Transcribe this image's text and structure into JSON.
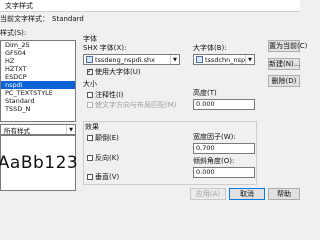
{
  "window": {
    "title": "文字样式"
  },
  "current_style": {
    "label": "当前文字样式：",
    "value": "Standard"
  },
  "styles": {
    "label": "样式(S):",
    "items": [
      "Dim_25",
      "GFS04",
      "HZ",
      "HZTXT",
      "ESDCP",
      "nspdi",
      "PC_TEXTSTYLE",
      "Standard",
      "TSSD_N"
    ],
    "selected_index": 5
  },
  "filter": {
    "value": "所有样式"
  },
  "preview": {
    "text": "AaBb123"
  },
  "font": {
    "group_label": "字体",
    "shx_label": "SHX 字体(X):",
    "shx_value": "tssdeng_nspdi.shx",
    "big_label": "大字体(B):",
    "big_value": "tssdchn_nspdi...",
    "use_big": {
      "label": "使用大字体(U)",
      "checked": true
    }
  },
  "size": {
    "group_label": "大小",
    "annotative": {
      "label": "注释性(I)",
      "checked": false
    },
    "match_orient": {
      "label": "使文字方向与布局匹配(M)",
      "checked": false
    },
    "height_label": "高度(T)",
    "height_value": "0.000"
  },
  "effects": {
    "group_label": "效果",
    "upside_down": {
      "label": "颠倒(E)",
      "checked": false
    },
    "backwards": {
      "label": "反向(K)",
      "checked": false
    },
    "vertical": {
      "label": "垂直(V)",
      "checked": false
    },
    "width_label": "宽度因子(W):",
    "width_value": "0.700",
    "oblique_label": "倾斜角度(O):",
    "oblique_value": "0.000"
  },
  "buttons": {
    "set_current": "置为当前(C)",
    "new": "新建(N)...",
    "delete": "删除(D)",
    "apply": "应用(A)",
    "cancel": "取消",
    "help": "帮助"
  },
  "colors": {
    "accent": "#0a64d6"
  }
}
